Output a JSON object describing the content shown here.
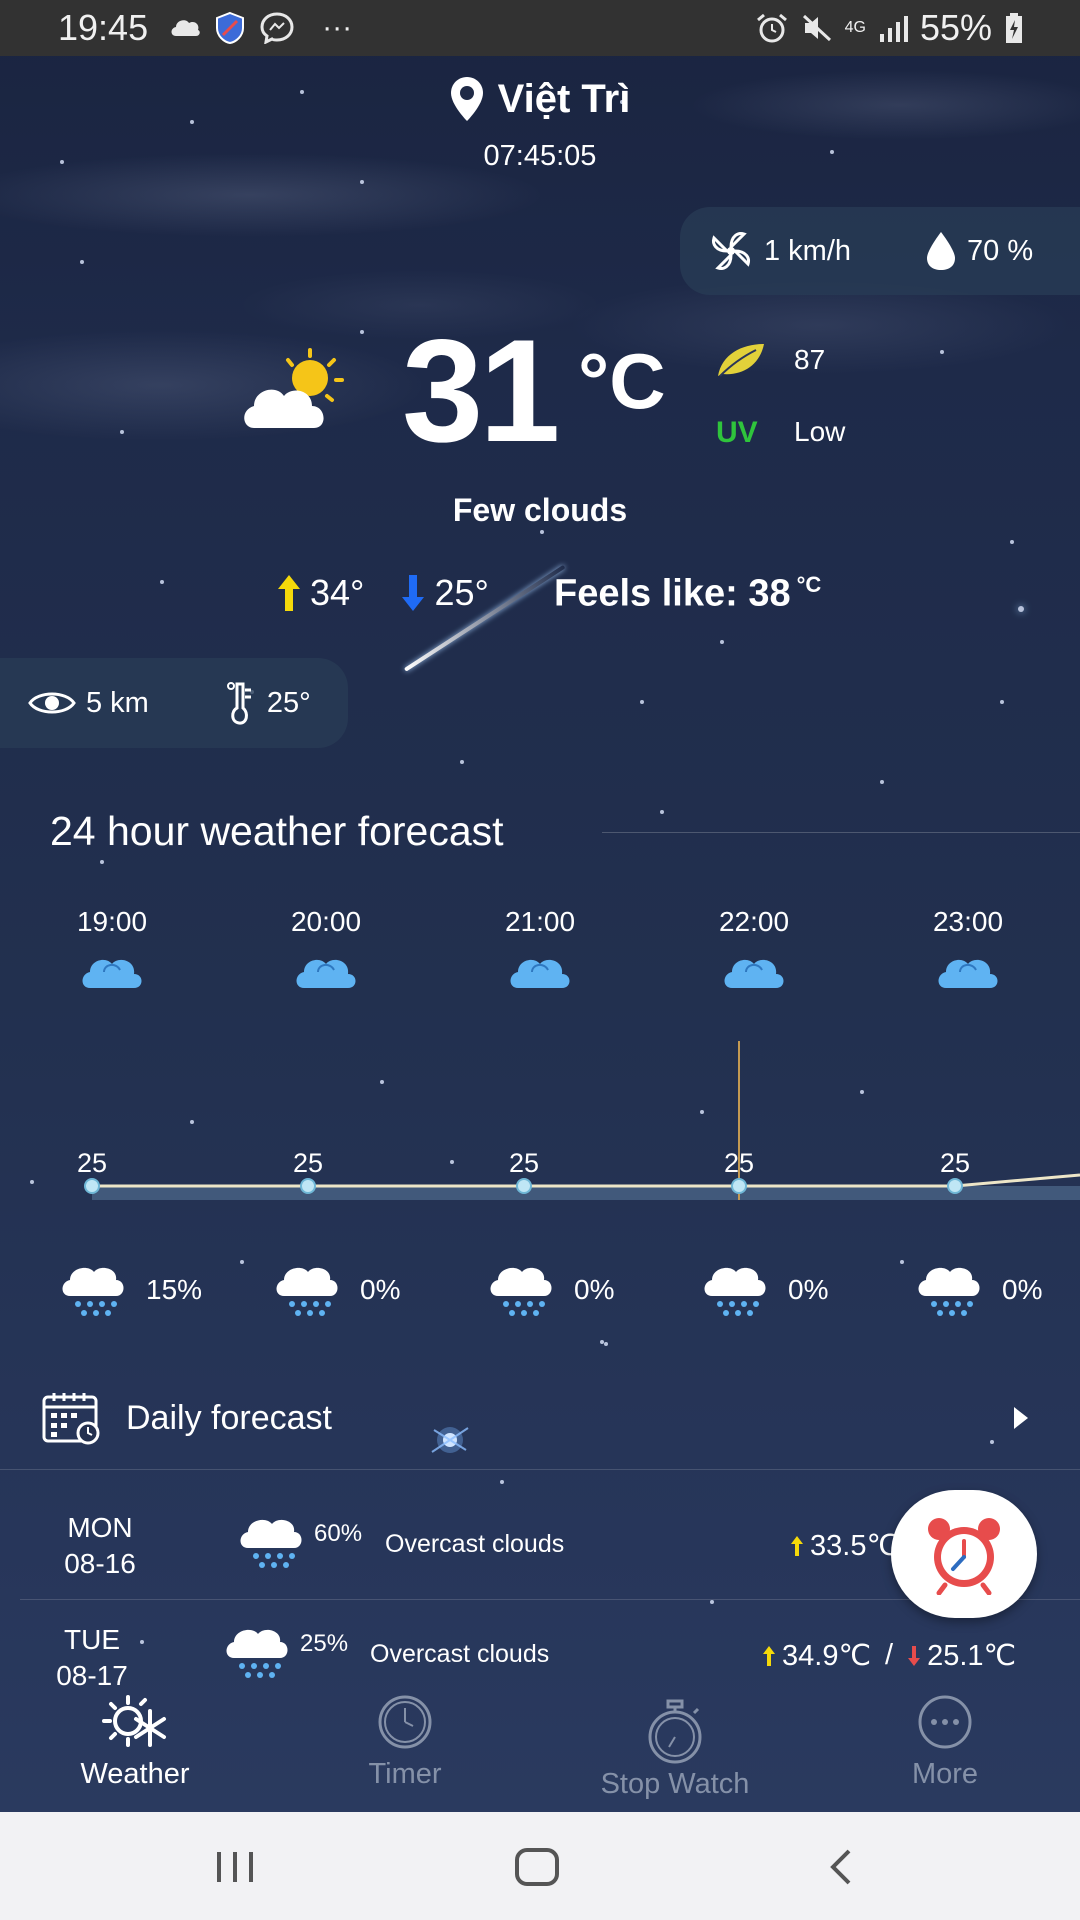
{
  "status_bar": {
    "time": "19:45",
    "network": "4G",
    "battery": "55%",
    "more": "···"
  },
  "location": {
    "city": "Việt Trì",
    "local_time": "07:45:05"
  },
  "wind_humidity": {
    "wind": "1 km/h",
    "humidity": "70 %"
  },
  "current": {
    "temp": "31",
    "unit": "°C",
    "aqi": "87",
    "uv_label": "UV",
    "uv_value": "Low",
    "condition": "Few clouds",
    "high": "34°",
    "low": "25°",
    "feels_like_label": "Feels like: 38",
    "feels_like_unit": "°C"
  },
  "visibility_dew": {
    "visibility": "5 km",
    "dew_point": "25°"
  },
  "hourly": {
    "title": "24 hour weather forecast",
    "hours": [
      "19:00",
      "20:00",
      "21:00",
      "22:00",
      "23:00"
    ],
    "temps": [
      "25",
      "25",
      "25",
      "25",
      "25"
    ],
    "rain_chance": [
      "15%",
      "0%",
      "0%",
      "0%",
      "0%"
    ]
  },
  "daily": {
    "title": "Daily forecast",
    "days": [
      {
        "day": "MON",
        "date": "08-16",
        "rain": "60%",
        "desc": "Overcast clouds",
        "high": "33.5℃"
      },
      {
        "day": "TUE",
        "date": "08-17",
        "rain": "25%",
        "desc": "Overcast clouds",
        "high": "34.9℃",
        "sep": "/",
        "low": "25.1℃"
      }
    ]
  },
  "tabs": {
    "weather": "Weather",
    "timer": "Timer",
    "stopwatch": "Stop Watch",
    "more": "More"
  },
  "colors": {
    "accent_yellow": "#f5d90a",
    "uv_green": "#2fc43c",
    "low_blue": "#1f6bf5",
    "cloud_blue": "#5fb3f2",
    "alarm_red": "#e74c4c"
  }
}
